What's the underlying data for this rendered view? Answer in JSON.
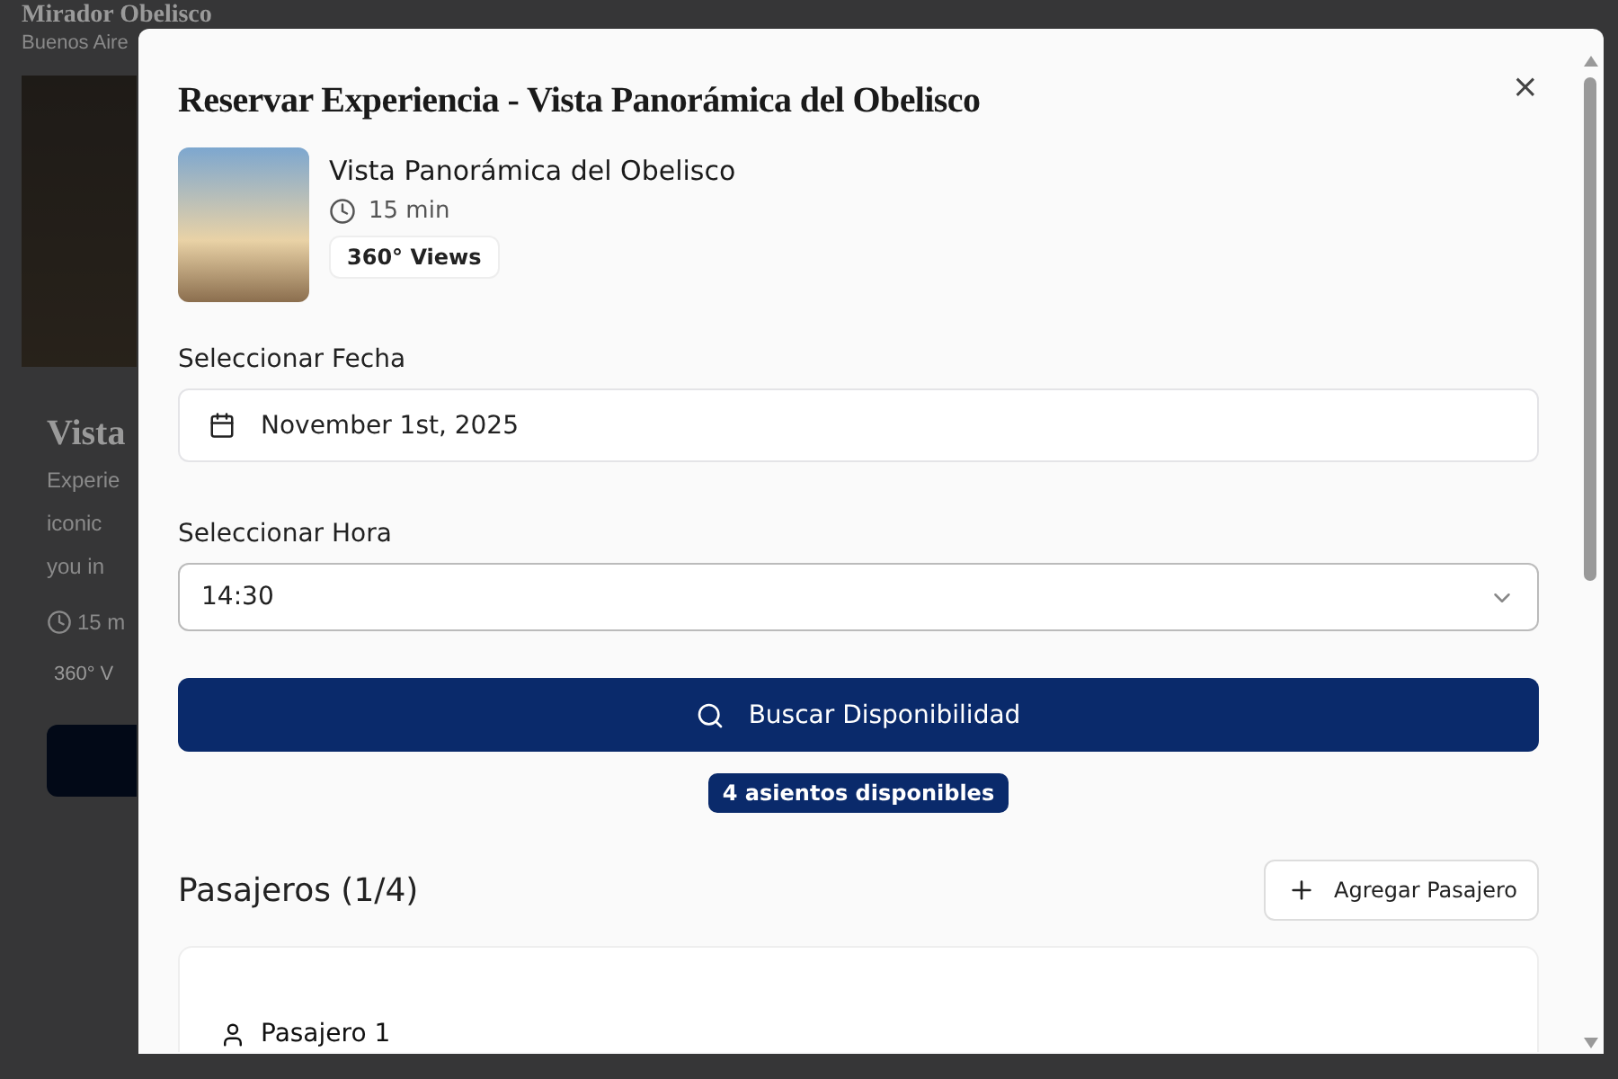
{
  "background_page": {
    "title": "Mirador Obelisco",
    "location": "Buenos Aire",
    "card": {
      "title": "Vista",
      "description_lines": [
        "Experie",
        "iconic",
        "you in"
      ],
      "duration": "15 m",
      "tag": "360° V"
    }
  },
  "modal": {
    "title": "Reservar Experiencia - Vista Panorámica del Obelisco",
    "close": "×",
    "experience": {
      "name": "Vista Panorámica del Obelisco",
      "duration": "15 min",
      "tag": "360° Views"
    },
    "date": {
      "label": "Seleccionar Fecha",
      "value": "November 1st, 2025"
    },
    "time": {
      "label": "Seleccionar Hora",
      "value": "14:30"
    },
    "search_button": "Buscar Disponibilidad",
    "availability": "4 asientos disponibles",
    "passengers": {
      "title": "Pasajeros (1/4)",
      "add_button": "Agregar Pasajero",
      "items": [
        {
          "label": "Pasajero 1"
        }
      ]
    }
  }
}
